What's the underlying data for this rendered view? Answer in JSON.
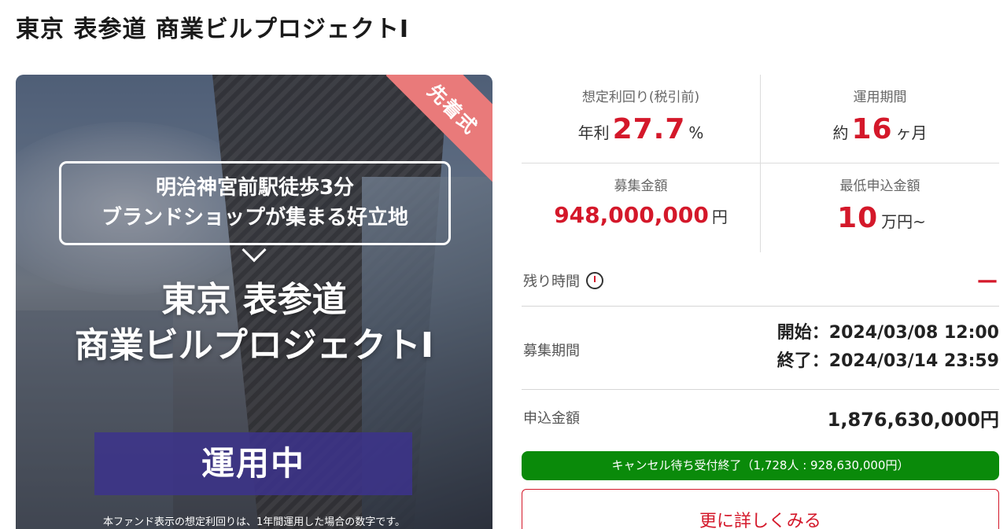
{
  "page": {
    "title": "東京 表参道 商業ビルプロジェクトⅠ"
  },
  "hero": {
    "ribbon": "先着式",
    "bubble_lines": [
      "明治神宮前駅徒歩3分",
      "ブランドショップが集まる好立地"
    ],
    "title_lines": [
      "東京 表参道",
      "商業ビルプロジェクトⅠ"
    ],
    "status": "運用中",
    "disclaimer": "本ファンド表示の想定利回りは、1年間運用した場合の数字です。"
  },
  "stats": {
    "yield": {
      "label": "想定利回り(税引前)",
      "prefix": "年利",
      "value": "27.7",
      "unit": "%"
    },
    "period": {
      "label": "運用期間",
      "prefix": "約",
      "value": "16",
      "unit": "ヶ月"
    },
    "raise": {
      "label": "募集金額",
      "value": "948,000,000",
      "unit": "円"
    },
    "minimum": {
      "label": "最低申込金額",
      "value": "10",
      "unit": "万円~"
    }
  },
  "remaining": {
    "label": "残り時間",
    "value": "—"
  },
  "recruit": {
    "label": "募集期間",
    "start": "開始：2024/03/08 12:00",
    "end": "終了：2024/03/14 23:59"
  },
  "applied": {
    "label": "申込金額",
    "value": "1,876,630,000円"
  },
  "waitlist": {
    "text": "キャンセル待ち受付終了（1,728人 : 928,630,000円）"
  },
  "detail_button": {
    "label": "更に詳しくみる"
  },
  "colors": {
    "accent": "#d4182a",
    "waitlist_green": "#0a8a0a",
    "ribbon": "#e97a7a",
    "status_box": "#3c328c"
  }
}
